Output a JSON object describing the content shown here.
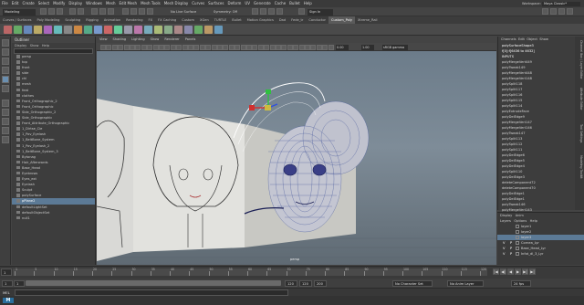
{
  "menubar": {
    "items": [
      "File",
      "Edit",
      "Create",
      "Select",
      "Modify",
      "Display",
      "Windows",
      "Mesh",
      "Edit Mesh",
      "Mesh Tools",
      "Mesh Display",
      "Curves",
      "Surfaces",
      "Deform",
      "UV",
      "Generate",
      "Cache",
      "Bullet",
      "Help"
    ],
    "workspace_label": "Workspace:",
    "workspace_value": "Maya Classic*"
  },
  "status": {
    "mode_dropdown": "Modeling",
    "no_live_surface": "No Live Surface",
    "symmetry": "Symmetry: Off",
    "sign_in": "Sign In"
  },
  "shelf_tabs": [
    "Curves / Surfaces",
    "Poly Modeling",
    "Sculpting",
    "Rigging",
    "Animation",
    "Rendering",
    "FX",
    "FX Caching",
    "Custom",
    "XGen",
    "TURTLE",
    "Bullet",
    "Motion Graphics",
    "Dad",
    "Fede_tr",
    "Conductor",
    "Custom_Poly",
    "Xtreme_Rail"
  ],
  "active_shelf_tab": "Custom_Poly",
  "outliner": {
    "title": "Outliner",
    "menu": [
      "Display",
      "Show",
      "Help"
    ],
    "items": [
      "persp",
      "top",
      "front",
      "side",
      "chl",
      "mesh",
      "feat",
      "clothes",
      "Front_Orthographic_2",
      "Front_Orthographic",
      "Side_Orthographic_2",
      "Side_Orthographic",
      "Front_Attribute_Orthographic",
      "1_Dirtse_Cie",
      "1_Pov_Eyelash",
      "1_BeltBone_System",
      "1_Pov_Eyelash_2",
      "1_BeltBone_System_3",
      "Bytonag",
      "Hair_Afterwards",
      "Base_Head",
      "Eyebrows",
      "Eyes_ext",
      "Eyelash",
      "Sculpt",
      "polySurface",
      "pPlane2",
      "defaultLightSet",
      "defaultObjectSet",
      "null1"
    ],
    "selected_index": 26
  },
  "viewport": {
    "menu": [
      "View",
      "Shading",
      "Lighting",
      "Show",
      "Renderer",
      "Panels"
    ],
    "toolbar_fields": {
      "field1": "0.00",
      "field2": "1.00",
      "colorspace": "sRGB gamma"
    },
    "camera_label": "persp"
  },
  "channelbox": {
    "menu": [
      "Channels",
      "Edit",
      "Object",
      "Show"
    ],
    "header": "polySurfaceShape3",
    "subheader": "f[0]:f[6436 to 4632]",
    "inputs_label": "INPUTS",
    "items": [
      "polyMergeVert449",
      "polyTweak149",
      "polyMergeVert448",
      "polyMergeVert148",
      "polySplit118",
      "polySplit117",
      "polySplit116",
      "polySplit115",
      "polySplit114",
      "polyExtrudeFace",
      "polyDelEdge9",
      "polyMergeVert147",
      "polyMergeVert146",
      "polyTweak147",
      "polySplit113",
      "polySplit112",
      "polySplit111",
      "polyDelEdge6",
      "polyDelEdge5",
      "polyDelEdge4",
      "polySplit110",
      "polyDelEdge3",
      "deleteComponent72",
      "deleteComponent70",
      "polyDelEdge1",
      "polyDelEdge1",
      "polyTweak146",
      "polyMergeVert143"
    ],
    "vertical_tabs": [
      "Channel Box / Layer Editor",
      "Attribute Editor",
      "Tool Settings",
      "Modeling Toolkit"
    ]
  },
  "layer_editor": {
    "tabs": [
      "Display",
      "Anim"
    ],
    "menu": [
      "Layers",
      "Options",
      "Help"
    ],
    "layers": [
      {
        "name": "layer1",
        "v": "",
        "p": "",
        "selected": false
      },
      {
        "name": "layer2",
        "v": "",
        "p": "",
        "selected": false
      },
      {
        "name": "layer3",
        "v": "",
        "p": "",
        "selected": true
      },
      {
        "name": "Cornea_Lyr",
        "v": "V",
        "p": "P",
        "selected": false
      },
      {
        "name": "Base_Head_Lyr",
        "v": "V",
        "p": "P",
        "selected": false
      },
      {
        "name": "Infot_dl_3_Lyr",
        "v": "V",
        "p": "P",
        "selected": false
      }
    ]
  },
  "timeline": {
    "ticks": [
      "1",
      "5",
      "10",
      "15",
      "20",
      "25",
      "30",
      "35",
      "40",
      "45",
      "50",
      "55",
      "60",
      "65",
      "70",
      "75",
      "80",
      "85",
      "90",
      "95",
      "100",
      "105",
      "110",
      "115",
      "120"
    ],
    "current_frame": "1",
    "playback_buttons": [
      "|◀",
      "◀|",
      "◀",
      "▶",
      "▶|",
      "▶|"
    ],
    "range_start": "1",
    "range_start2": "1",
    "range_end": "120",
    "range_end2": "120",
    "range_end3": "200",
    "character_set": "No Character Set",
    "anim_layer": "No Anim Layer",
    "fps": "24 fps"
  },
  "command": {
    "lang": "MEL",
    "text": ""
  },
  "colors": {
    "selection": "#5c7a96",
    "viewport_top": "#6c7c8a",
    "wire": "#2a3f8f",
    "manip_x": "#d03030",
    "manip_y": "#30c040",
    "manip_z": "#3050e0"
  }
}
